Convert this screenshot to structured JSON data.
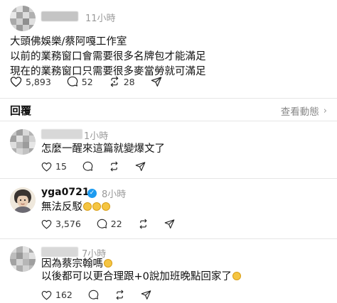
{
  "main_post": {
    "time": "11小時",
    "lines": [
      "大頭佛娛樂/蔡阿嘎工作室",
      "以前的業務窗口會需要很多名牌包才能滿足",
      "現在的業務窗口只需要很多麥當勞就可滿足"
    ],
    "likes": "5,893",
    "comments": "52",
    "reposts": "28"
  },
  "replies_header": {
    "label": "回覆",
    "activity_link": "查看動態"
  },
  "replies": [
    {
      "time": "1小時",
      "lines": [
        "怎麼一醒來這篇就變爆文了"
      ],
      "likes": "15"
    },
    {
      "username": "yga0721",
      "time": "8小時",
      "lines": [
        "無法反駁"
      ],
      "likes": "3,576",
      "comments": "22"
    },
    {
      "time": "7小時",
      "lines": [
        "因為蔡宗翰嗎",
        "以後都可以更合理跟+0說加班晚點回家了"
      ],
      "likes": "162"
    }
  ],
  "icons": {
    "like": "heart-icon",
    "comment": "comment-icon",
    "repost": "repost-icon",
    "share": "share-icon",
    "verified": "verified-badge-icon",
    "emoji": "grinning-face-emoji"
  },
  "colors": {
    "verified": "#1d9bf0",
    "muted": "#999999",
    "divider": "#e6e6e6"
  }
}
